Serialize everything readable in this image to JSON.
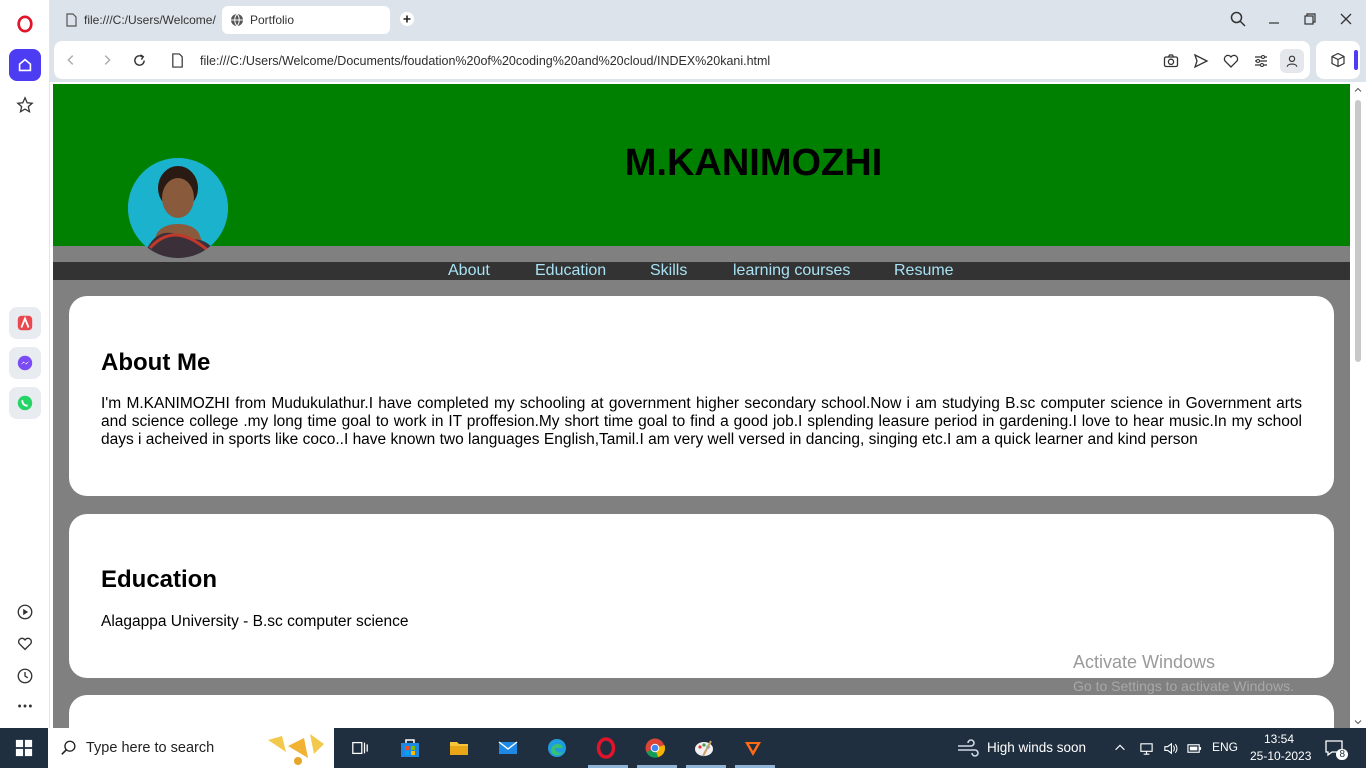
{
  "browser": {
    "tabs": [
      {
        "label": "file:///C:/Users/Welcome/"
      },
      {
        "label": "Portfolio"
      }
    ],
    "url": "file:///C:/Users/Welcome/Documents/foudation%20of%20coding%20and%20cloud/INDEX%20kani.html"
  },
  "page": {
    "name": "M.KANIMOZHI",
    "nav": [
      "About",
      "Education",
      "Skills",
      "learning courses",
      "Resume"
    ],
    "about": {
      "heading": "About Me",
      "text": "I'm M.KANIMOZHI from Mudukulathur.I have completed my schooling at government higher secondary school.Now i am studying B.sc computer science in Government arts and science college .my long time goal to work in IT proffesion.My short time goal to find a good job.I splending leasure period in gardening.I love to hear music.In my school days i acheived in sports like coco..I have known two languages English,Tamil.I am very well versed in dancing, singing etc.I am a quick learner and kind person"
    },
    "education": {
      "heading": "Education",
      "text": "Alagappa University - B.sc computer science"
    }
  },
  "watermark": {
    "title": "Activate Windows",
    "subtitle": "Go to Settings to activate Windows."
  },
  "taskbar": {
    "search_placeholder": "Type here to search",
    "weather": "High winds soon",
    "language": "ENG",
    "time": "13:54",
    "date": "25-10-2023",
    "notifications": "8"
  },
  "colors": {
    "header_bg": "#008000",
    "nav_bg": "#333333",
    "nav_link": "#a9e2f5",
    "page_bg": "#808080"
  }
}
